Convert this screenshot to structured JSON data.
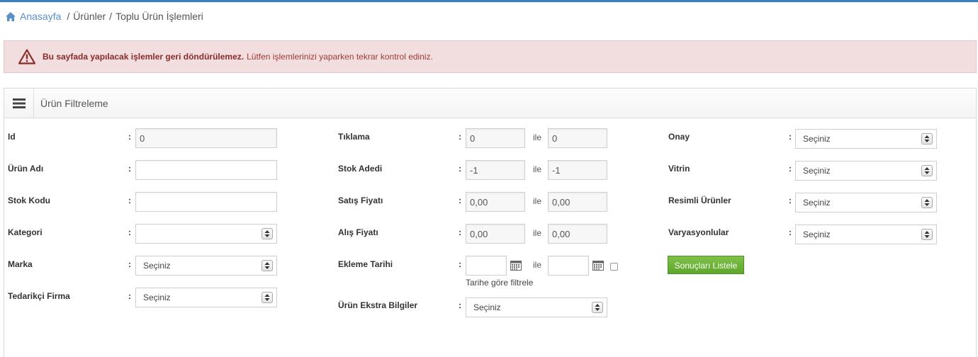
{
  "breadcrumb": {
    "home": "Anasayfa",
    "sep1": "/",
    "products": "Ürünler",
    "sep2": "/",
    "current": "Toplu Ürün İşlemleri"
  },
  "alert": {
    "strong": "Bu sayfada yapılacak işlemler geri döndürülemez.",
    "text": "Lütfen işlemlerinizi yaparken tekrar kontrol ediniz."
  },
  "panel": {
    "title": "Ürün Filtreleme"
  },
  "colon": ":",
  "ile": "ile",
  "col1": {
    "id": {
      "label": "Id",
      "value": "0"
    },
    "name": {
      "label": "Ürün Adı",
      "value": ""
    },
    "code": {
      "label": "Stok Kodu",
      "value": ""
    },
    "category": {
      "label": "Kategori",
      "value": ""
    },
    "brand": {
      "label": "Marka",
      "value": "Seçiniz"
    },
    "supplier": {
      "label": "Tedarikçi Firma",
      "value": "Seçiniz"
    }
  },
  "col2": {
    "clicks": {
      "label": "Tıklama",
      "from": "0",
      "to": "0"
    },
    "stock": {
      "label": "Stok Adedi",
      "from": "-1",
      "to": "-1"
    },
    "sale_price": {
      "label": "Satış Fiyatı",
      "from": "0,00",
      "to": "0,00"
    },
    "buy_price": {
      "label": "Alış Fiyatı",
      "from": "0,00",
      "to": "0,00"
    },
    "date": {
      "label": "Ekleme Tarihi",
      "from": "",
      "to": "",
      "hint": "Tarihe göre filtrele"
    },
    "extra": {
      "label": "Ürün Ekstra Bilgiler",
      "value": "Seçiniz"
    }
  },
  "col3": {
    "approval": {
      "label": "Onay",
      "value": "Seçiniz"
    },
    "showcase": {
      "label": "Vitrin",
      "value": "Seçiniz"
    },
    "with_images": {
      "label": "Resimli Ürünler",
      "value": "Seçiniz"
    },
    "variations": {
      "label": "Varyasyonlular",
      "value": "Seçiniz"
    }
  },
  "list_button": "Sonuçları Listele",
  "colors": {
    "accent": "#3a7fc1",
    "alert_bg": "#f2dede",
    "alert_text": "#8a2b2b",
    "button_green": "#6cb33a"
  }
}
